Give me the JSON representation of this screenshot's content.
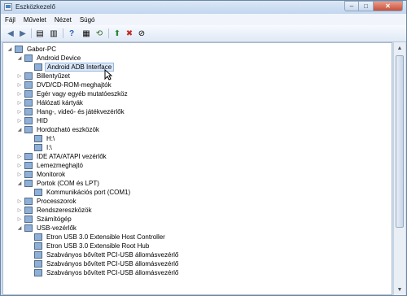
{
  "window": {
    "title": "Eszközkezelő"
  },
  "window_buttons": {
    "minimize": "–",
    "maximize": "□",
    "close": "✕"
  },
  "menu": [
    "Fájl",
    "Művelet",
    "Nézet",
    "Súgó"
  ],
  "toolbar": {
    "back": "◀",
    "forward": "▶",
    "properties": "▤",
    "list": "▥",
    "help": "?",
    "view": "▦",
    "scan": "⟲",
    "update": "⬆",
    "uninstall": "✖",
    "disable": "⊘"
  },
  "tree": [
    {
      "label": "Gabor-PC",
      "expander": "◢"
    },
    {
      "label": "Android Device",
      "expander": "◢"
    },
    {
      "label": "Android ADB Interface",
      "expander": ""
    },
    {
      "label": "Billentyűzet",
      "expander": "▷"
    },
    {
      "label": "DVD/CD-ROM-meghajtók",
      "expander": "▷"
    },
    {
      "label": "Egér vagy egyéb mutatóeszköz",
      "expander": "▷"
    },
    {
      "label": "Hálózati kártyák",
      "expander": "▷"
    },
    {
      "label": "Hang-, videó- és játékvezérlők",
      "expander": "▷"
    },
    {
      "label": "HID",
      "expander": "▷"
    },
    {
      "label": "Hordozható eszközök",
      "expander": "◢"
    },
    {
      "label": "H:\\",
      "expander": ""
    },
    {
      "label": "I:\\",
      "expander": ""
    },
    {
      "label": "IDE ATA/ATAPI vezérlők",
      "expander": "▷"
    },
    {
      "label": "Lemezmeghajtó",
      "expander": "▷"
    },
    {
      "label": "Monitorok",
      "expander": "▷"
    },
    {
      "label": "Portok (COM és LPT)",
      "expander": "◢"
    },
    {
      "label": "Kommunikációs port (COM1)",
      "expander": ""
    },
    {
      "label": "Processzorok",
      "expander": "▷"
    },
    {
      "label": "Rendszereszközök",
      "expander": "▷"
    },
    {
      "label": "Számítógép",
      "expander": "▷"
    },
    {
      "label": "USB-vezérlők",
      "expander": "◢"
    },
    {
      "label": "Etron USB 3.0 Extensible Host Controller",
      "expander": ""
    },
    {
      "label": "Etron USB 3.0 Extensible Root Hub",
      "expander": ""
    },
    {
      "label": "Szabványos bővített PCI-USB állomásvezérlő",
      "expander": ""
    },
    {
      "label": "Szabványos bővített PCI-USB állomásvezérlő",
      "expander": ""
    },
    {
      "label": "Szabványos bővített PCI-USB állomásvezérlő",
      "expander": ""
    }
  ],
  "scrollbar": {
    "up": "▲",
    "down": "▼"
  }
}
